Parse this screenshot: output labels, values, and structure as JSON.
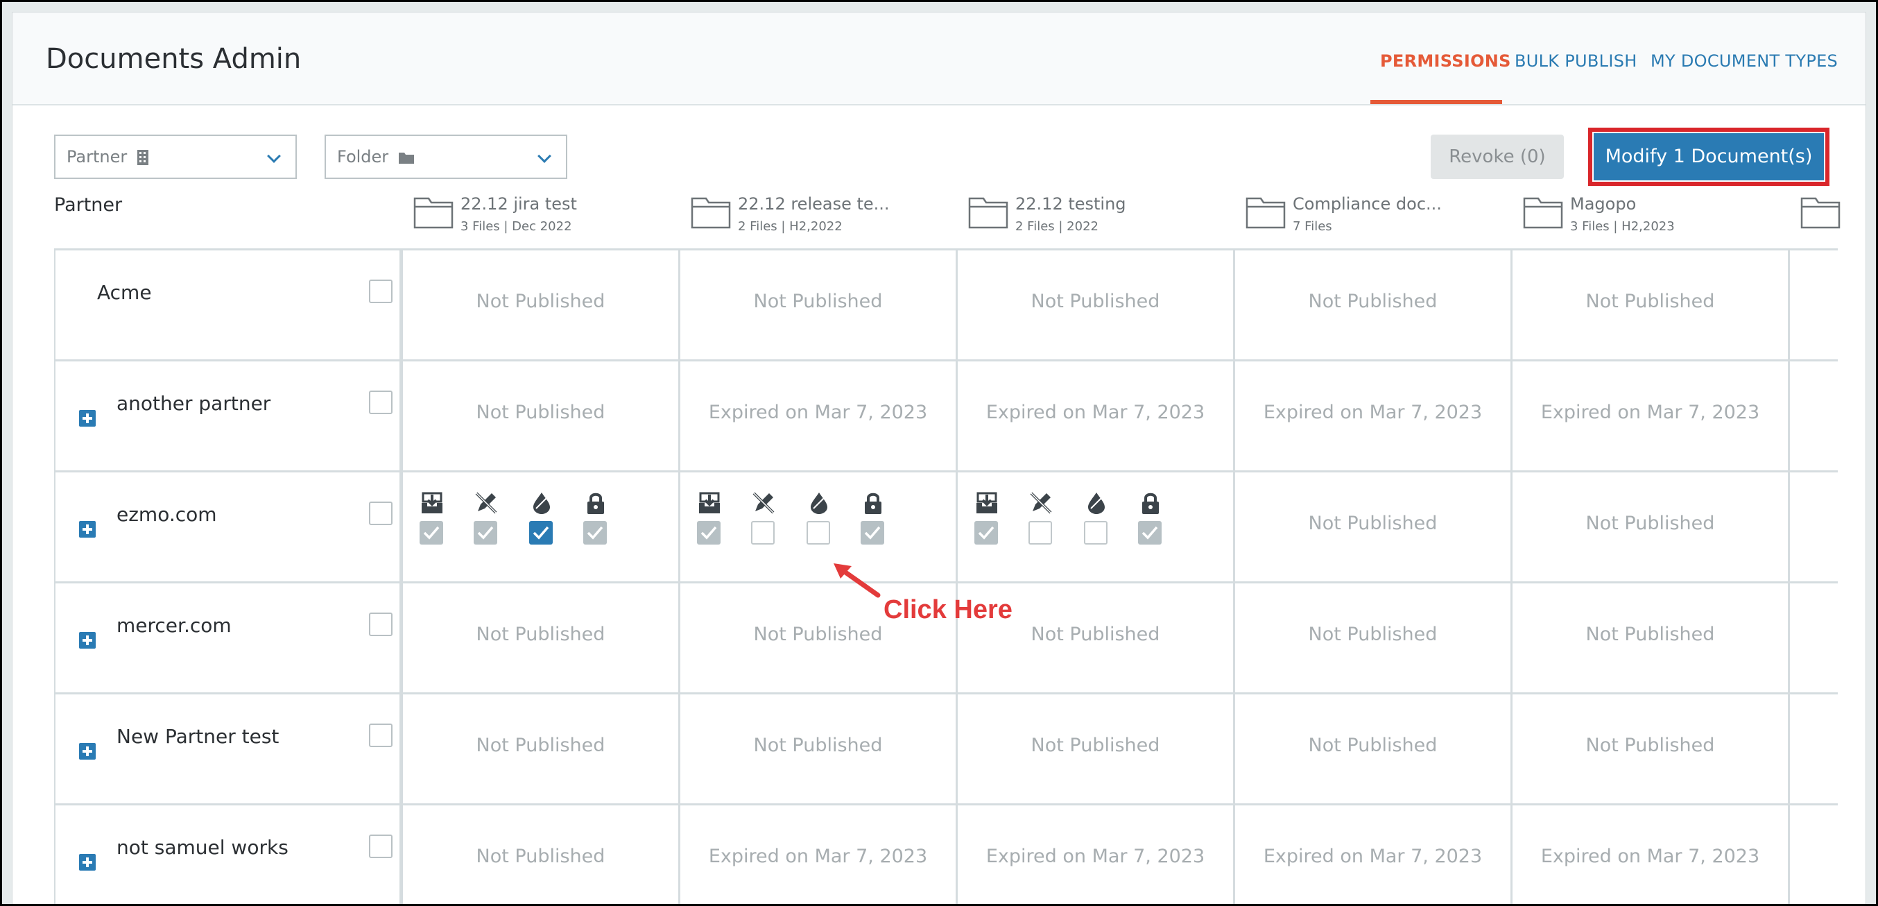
{
  "header": {
    "title": "Documents Admin",
    "tabs": [
      {
        "label": "PERMISSIONS",
        "active": true
      },
      {
        "label": "BULK PUBLISH",
        "active": false
      },
      {
        "label": "MY DOCUMENT TYPES",
        "active": false
      }
    ]
  },
  "toolbar": {
    "partner_filter": "Partner",
    "folder_filter": "Folder",
    "revoke_label": "Revoke (0)",
    "modify_label": "Modify 1 Document(s)"
  },
  "table": {
    "partner_header": "Partner",
    "folders": [
      {
        "name": "22.12 jira test",
        "meta": "3 Files | Dec 2022"
      },
      {
        "name": "22.12 release te...",
        "meta": "2 Files | H2,2022"
      },
      {
        "name": "22.12 testing",
        "meta": "2 Files | 2022"
      },
      {
        "name": "Compliance doc...",
        "meta": "7 Files"
      },
      {
        "name": "Magopo",
        "meta": "3 Files | H2,2023"
      }
    ],
    "rows": [
      {
        "partner": "Acme",
        "expandable": false,
        "cells": [
          "Not Published",
          "Not Published",
          "Not Published",
          "Not Published",
          "Not Published"
        ]
      },
      {
        "partner": "another partner",
        "expandable": true,
        "cells": [
          "Not Published",
          "Expired on Mar 7, 2023",
          "Expired on Mar 7, 2023",
          "Expired on Mar 7, 2023",
          "Expired on Mar 7, 2023"
        ]
      },
      {
        "partner": "ezmo.com",
        "expandable": true,
        "cells": [
          "",
          "",
          "",
          "Not Published",
          "Not Published"
        ]
      },
      {
        "partner": "mercer.com",
        "expandable": true,
        "cells": [
          "Not Published",
          "Not Published",
          "Not Published",
          "Not Published",
          "Not Published"
        ]
      },
      {
        "partner": "New Partner test",
        "expandable": true,
        "cells": [
          "Not Published",
          "Not Published",
          "Not Published",
          "Not Published",
          "Not Published"
        ]
      },
      {
        "partner": "not samuel works",
        "expandable": true,
        "cells": [
          "Not Published",
          "Expired on Mar 7, 2023",
          "Expired on Mar 7, 2023",
          "Expired on Mar 7, 2023",
          "Expired on Mar 7, 2023"
        ]
      }
    ],
    "permission_icons": [
      "download-icon",
      "edit-icon",
      "watermark-icon",
      "lock-icon"
    ],
    "ezmo_permissions": [
      [
        "on",
        "on",
        "active",
        "on"
      ],
      [
        "on",
        "off",
        "off",
        "on"
      ],
      [
        "on",
        "off",
        "off",
        "on"
      ]
    ]
  },
  "annotation": {
    "text": "Click Here",
    "color": "#e33b3b"
  },
  "colors": {
    "accent": "#2a7bb4",
    "active_tab": "#e55a38",
    "highlight_border": "#d9262b"
  }
}
